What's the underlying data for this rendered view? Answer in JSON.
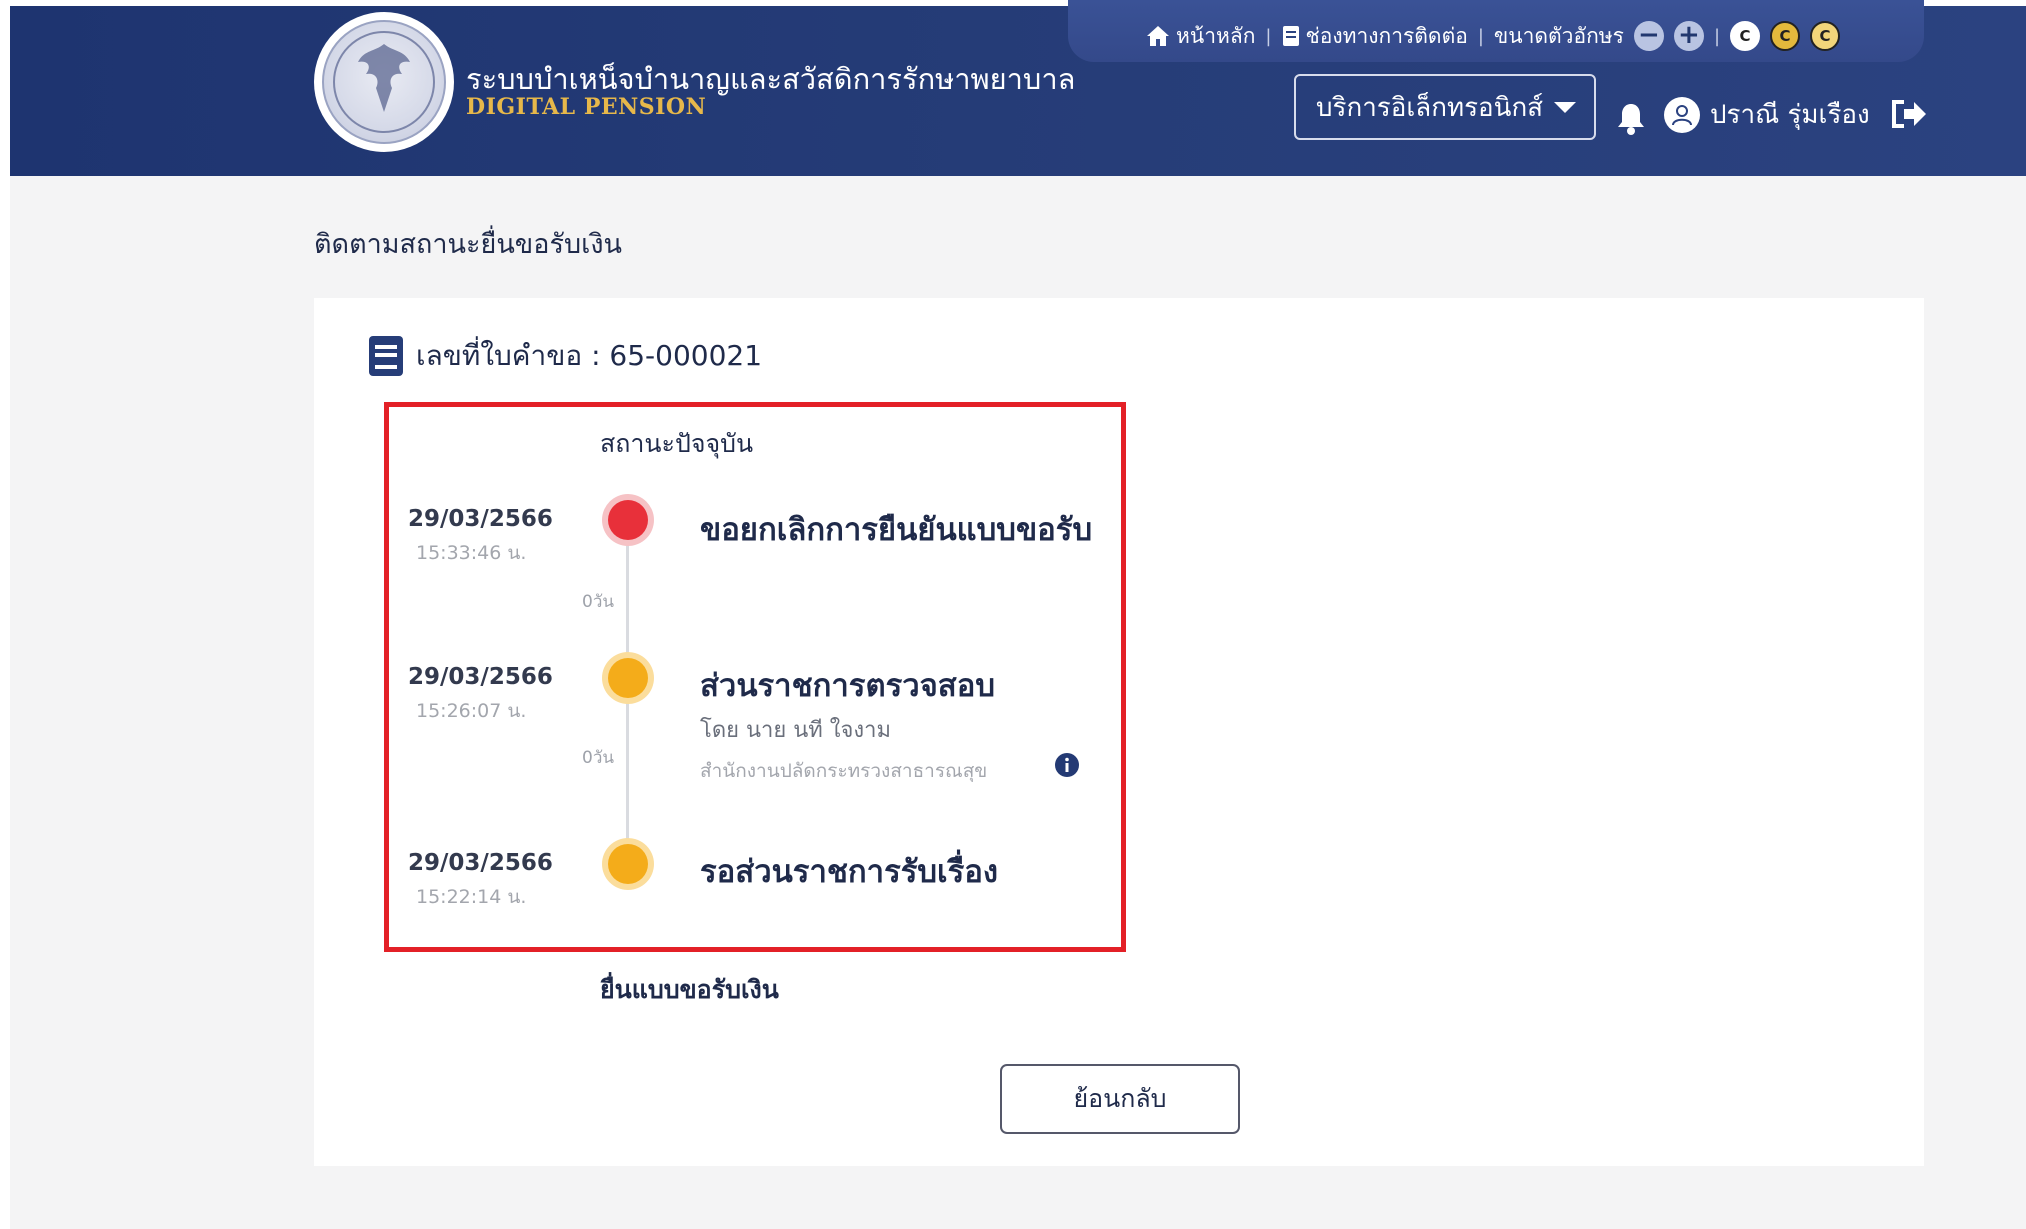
{
  "header": {
    "site_title": "ระบบบำเหน็จบำนาญและสวัสดิการรักษาพยาบาล",
    "site_subtitle": "DIGITAL PENSION",
    "util": {
      "home_label": "หน้าหลัก",
      "contact_label": "ช่องทางการติดต่อ",
      "font_size_label": "ขนาดตัวอักษร",
      "font_decrease_symbol": "−",
      "font_increase_symbol": "+",
      "contrast_symbol": "C"
    },
    "service_dropdown_label": "บริการอิเล็กทรอนิกส์",
    "user_name": "ปราณี รุ่มเรือง",
    "icons": [
      "home-icon",
      "document-icon",
      "bell-icon",
      "user-avatar-icon",
      "logout-icon",
      "chevron-down-icon"
    ],
    "colors": {
      "header_bg": "#1e3470",
      "subtitle": "#e7b84a"
    }
  },
  "main": {
    "page_title": "ติดตามสถานะยื่นขอรับเงิน",
    "request_label": "เลขที่ใบคำขอ : 65-000021",
    "status_title": "สถานะปัจจุบัน",
    "events": [
      {
        "date": "29/03/2566",
        "time": "15:33:46 น.",
        "title": "ขอยกเลิกการยืนยันแบบขอรับ",
        "status_color": "#e8303a"
      },
      {
        "date": "29/03/2566",
        "time": "15:26:07 น.",
        "title": "ส่วนราชการตรวจสอบ",
        "by": "โดย นาย นที ใจงาม",
        "org": "สำนักงานปลัดกระทรวงสาธารณสุข",
        "status_color": "#f4ac1a"
      },
      {
        "date": "29/03/2566",
        "time": "15:22:14 น.",
        "title": "รอส่วนราชการรับเรื่อง",
        "status_color": "#f4ac1a"
      }
    ],
    "gap_labels": [
      "0วัน",
      "0วัน"
    ],
    "footer_step": "ยื่นแบบขอรับเงิน",
    "back_button": "ย้อนกลับ",
    "colors": {
      "highlight_border": "#e32027"
    }
  }
}
